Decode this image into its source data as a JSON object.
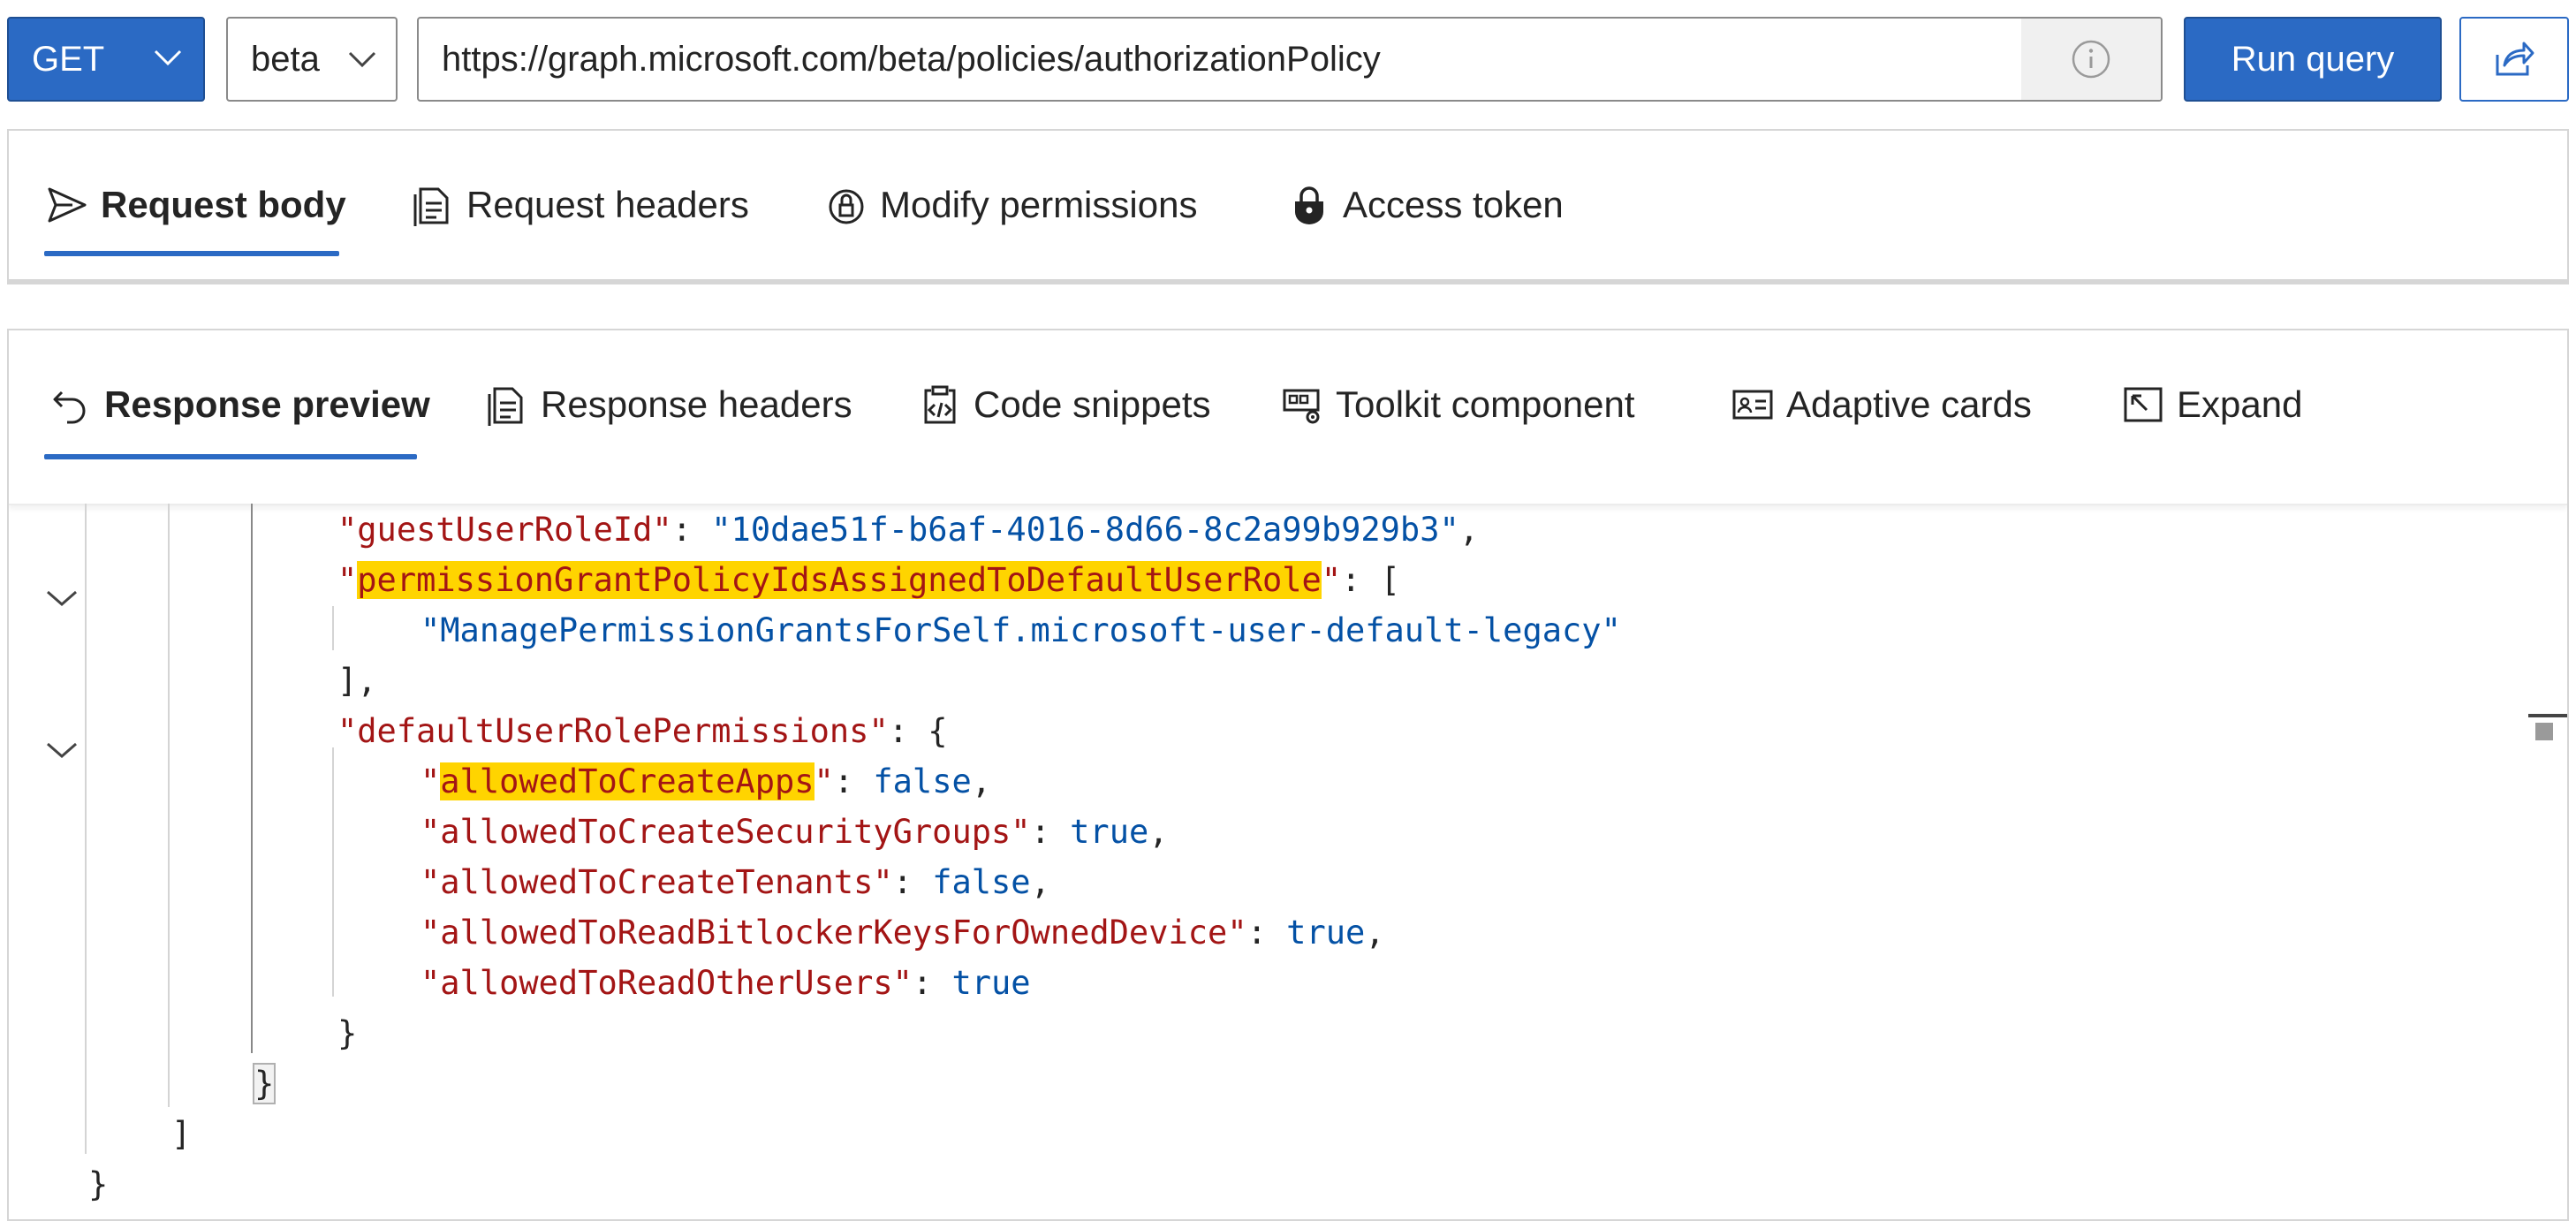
{
  "query_bar": {
    "method": "GET",
    "version": "beta",
    "url": "https://graph.microsoft.com/beta/policies/authorizationPolicy",
    "run_label": "Run query"
  },
  "request_tabs": [
    {
      "label": "Request body",
      "icon": "send-icon",
      "active": true
    },
    {
      "label": "Request headers",
      "icon": "document-icon",
      "active": false
    },
    {
      "label": "Modify permissions",
      "icon": "lock-shield-icon",
      "active": false
    },
    {
      "label": "Access token",
      "icon": "lock-icon",
      "active": false
    }
  ],
  "response_tabs": [
    {
      "label": "Response preview",
      "icon": "undo-arrow-icon",
      "active": true
    },
    {
      "label": "Response headers",
      "icon": "document-icon",
      "active": false
    },
    {
      "label": "Code snippets",
      "icon": "clipboard-code-icon",
      "active": false
    },
    {
      "label": "Toolkit component",
      "icon": "toolkit-icon",
      "active": false
    },
    {
      "label": "Adaptive cards",
      "icon": "contact-card-icon",
      "active": false
    },
    {
      "label": "Expand",
      "icon": "expand-icon",
      "active": false
    }
  ],
  "response_json": {
    "guestUserRoleId_key": "guestUserRoleId",
    "guestUserRoleId_value": "10dae51f-b6af-4016-8d66-8c2a99b929b3",
    "permissionGrant_key": "permissionGrantPolicyIdsAssignedToDefaultUserRole",
    "permissionGrant_value": "ManagePermissionGrantsForSelf.microsoft-user-default-legacy",
    "defaultUserRolePermissions_key": "defaultUserRolePermissions",
    "perm_keys": [
      "allowedToCreateApps",
      "allowedToCreateSecurityGroups",
      "allowedToCreateTenants",
      "allowedToReadBitlockerKeysForOwnedDevice",
      "allowedToReadOtherUsers"
    ],
    "perm_values": [
      "false",
      "true",
      "false",
      "true",
      "true"
    ]
  },
  "colors": {
    "accent": "#2b6ac4",
    "json_key": "#a31515",
    "json_value": "#0451a5",
    "highlight": "#ffd400"
  }
}
